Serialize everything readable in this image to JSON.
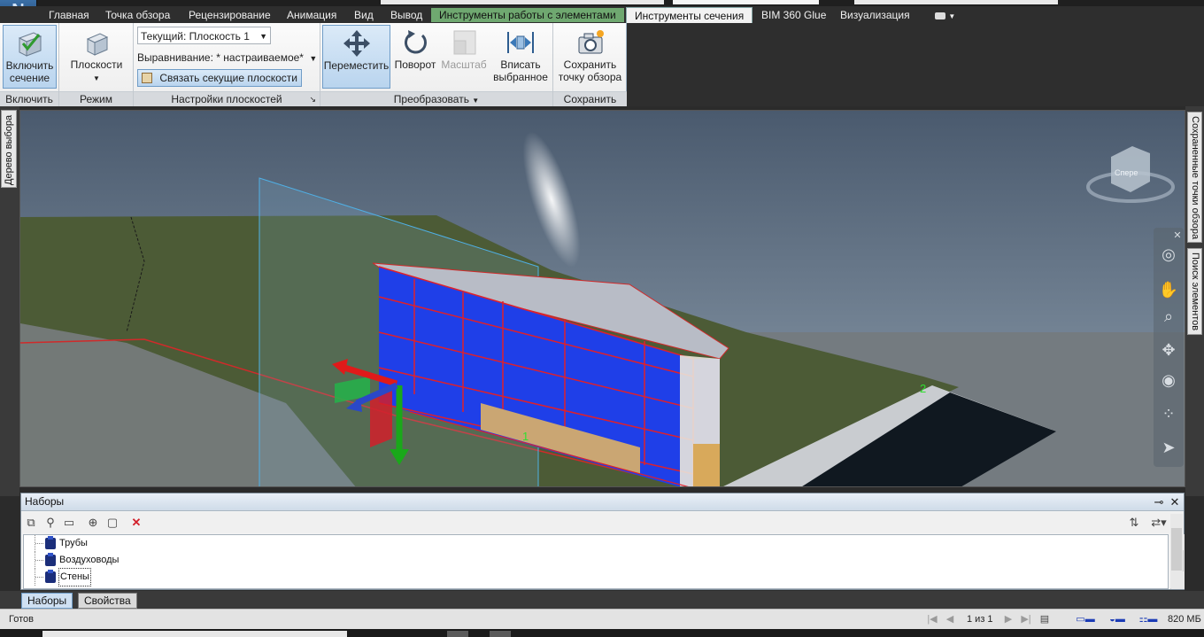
{
  "app": {
    "logo_letter": "N"
  },
  "ribbon_tabs": [
    "Главная",
    "Точка обзора",
    "Рецензирование",
    "Анимация",
    "Вид",
    "Вывод",
    "Инструменты работы с элементами",
    "Инструменты сечения",
    "BIM 360 Glue",
    "Визуализация"
  ],
  "ribbon": {
    "enable": {
      "button_label": "Включить\nсечение",
      "group_title": "Включить"
    },
    "mode": {
      "button_label": "Плоскости",
      "group_title": "Режим"
    },
    "plane_settings": {
      "current_plane": "Текущий: Плоскость 1",
      "alignment": "Выравнивание: * настраиваемое*",
      "link_planes": "Связать секущие плоскости",
      "group_title": "Настройки плоскостей"
    },
    "transform": {
      "move": "Переместить",
      "rotate": "Поворот",
      "scale": "Масштаб",
      "fit": "Вписать\nвыбранное",
      "group_title": "Преобразовать"
    },
    "save": {
      "button_label": "Сохранить\nточку обзора",
      "group_title": "Сохранить"
    }
  },
  "side_panels": {
    "left": "Дерево выбора",
    "right_top": "Сохраненные точки обзора",
    "right_bottom": "Поиск элементов"
  },
  "viewport": {
    "viewcube_label": "Спере",
    "plane_markers": [
      "1",
      "2"
    ],
    "colors": {
      "sky_top": "#4a5a6e",
      "sky_bottom": "#8f9fae",
      "ground": "#4c5b36",
      "section_fill": "#1f3fe8",
      "section_edges": "#e0202a",
      "roof": "#b8bcc6",
      "road": "#101820"
    }
  },
  "sets_panel": {
    "title": "Наборы",
    "items": [
      "Трубы",
      "Воздуховоды",
      "Стены"
    ],
    "selected_index": 2
  },
  "bottom_tabs": [
    "Наборы",
    "Свойства"
  ],
  "status": {
    "ready": "Готов",
    "page": "1 из 1",
    "memory": "820 МБ"
  }
}
